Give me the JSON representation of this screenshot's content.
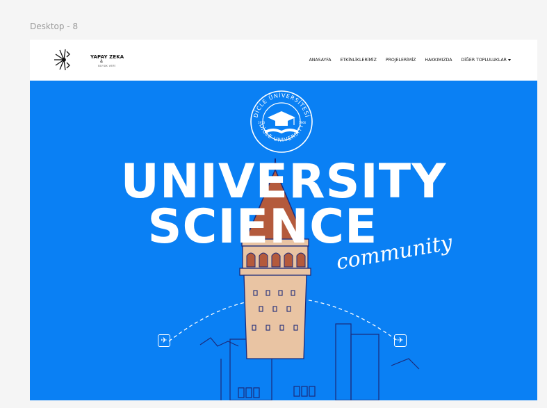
{
  "frame": {
    "label": "Desktop - 8"
  },
  "logo": {
    "title": "YAPAY ZEKA",
    "amp": "&",
    "subtitle": "BÜYÜK VERİ"
  },
  "nav": {
    "items": [
      {
        "label": "ANASAYFA"
      },
      {
        "label": "ETKİNLİKLERİMİZ"
      },
      {
        "label": "PROJELERİMİZ"
      },
      {
        "label": "HAKKIMIZDA"
      },
      {
        "label": "DİĞER TOPLULUKLAR"
      }
    ]
  },
  "hero": {
    "line1": "UNIVERSITY",
    "line2": "SCIENCE",
    "script": "community",
    "seal_top": "DİCLE ÜNİVERSİTESİ",
    "seal_bottom": "DİCLE UNIVERSITY",
    "seal_year_left": "1973",
    "seal_year_right": "1966"
  },
  "colors": {
    "hero_bg": "#0a80f4",
    "tower_roof": "#b45a3c",
    "tower_body": "#e9c4a3",
    "outline": "#1c2a7a"
  }
}
